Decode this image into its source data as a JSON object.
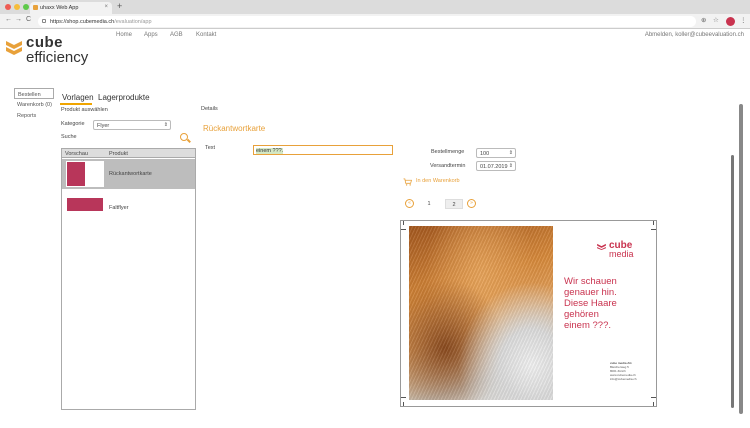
{
  "browser": {
    "tab_title": "uhaxx Web App",
    "tab_close": "×",
    "new_tab": "+",
    "url_host": "https://shop.cubemedia.ch",
    "url_path": "/evaluation/app",
    "back": "←",
    "forward": "→",
    "reload": "C"
  },
  "logo": {
    "line1": "cube",
    "line2": "efficiency"
  },
  "topnav": {
    "home": "Home",
    "apps": "Apps",
    "agb": "AGB",
    "kontakt": "Kontakt"
  },
  "user": {
    "logout": "Abmelden,",
    "email": "koller@cubeevaluation.ch"
  },
  "sidebar": {
    "items": [
      {
        "label": "Bestellen"
      },
      {
        "label": "Warenkorb (0)"
      },
      {
        "label": "Reports"
      }
    ]
  },
  "tabs": {
    "vorlagen": "Vorlagen",
    "lagerprodukte": "Lagerprodukte"
  },
  "filter": {
    "section_label": "Produkt auswählen",
    "category_label": "Kategorie",
    "category_value": "Flyer",
    "search_label": "Suche"
  },
  "product_list": {
    "headers": {
      "preview": "Vorschau",
      "product": "Produkt"
    },
    "rows": [
      {
        "name": "Rückantwortkarte"
      },
      {
        "name": "Faltflyer"
      }
    ]
  },
  "details": {
    "label": "Details",
    "title": "Rückantwortkarte",
    "text_label": "Text",
    "text_value": "einem ???."
  },
  "order": {
    "quantity_label": "Bestellmenge",
    "quantity_value": "100",
    "date_label": "Versandtermin",
    "date_value": "01.07.2019",
    "cart_label": "In den Warenkorb"
  },
  "pager": {
    "current": "1",
    "total": "2",
    "prev": "«",
    "next": "»"
  },
  "preview": {
    "logo1": "cube",
    "logo2": "media",
    "message_lines": [
      "Wir schauen",
      "genauer hin.",
      "Diese Haare",
      "gehören",
      "einem ???."
    ],
    "address_lines": [
      "cube media AG",
      "Bleicherweg 5",
      "8001 Zürich",
      "www.cubemedia.ch",
      "info@cubemedia.ch"
    ]
  },
  "colors": {
    "accent": "#e8a13a",
    "brand": "#c9334f",
    "selected_row": "#bdbdbd"
  }
}
